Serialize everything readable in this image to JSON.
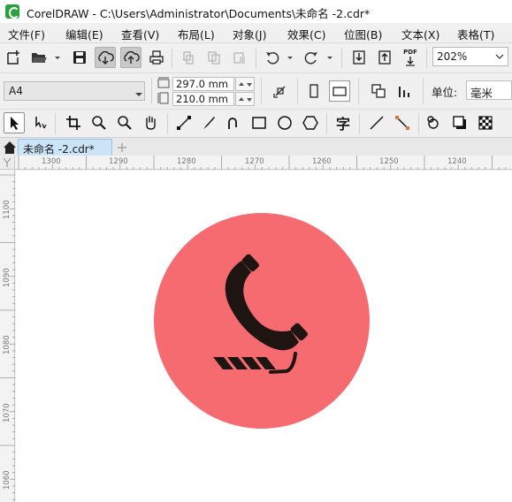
{
  "window": {
    "title": "CorelDRAW - C:\\Users\\Administrator\\Documents\\未命名 -2.cdr*"
  },
  "menu": [
    {
      "label": "文件(F)"
    },
    {
      "label": "编辑(E)"
    },
    {
      "label": "查看(V)"
    },
    {
      "label": "布局(L)"
    },
    {
      "label": "对象(J)"
    },
    {
      "label": "效果(C)"
    },
    {
      "label": "位图(B)"
    },
    {
      "label": "文本(X)"
    },
    {
      "label": "表格(T)"
    }
  ],
  "standard_toolbar": {
    "icons": [
      "new-document-icon",
      "open-folder-icon",
      "save-icon",
      "cloud-download-icon",
      "cloud-upload-icon",
      "print-icon",
      "cut-icon",
      "copy-icon",
      "paste-icon",
      "undo-icon",
      "redo-icon",
      "import-icon",
      "export-icon",
      "pdf-icon"
    ],
    "pdf_label": "PDF",
    "zoom_value": "202%"
  },
  "property_bar": {
    "page_size": "A4",
    "width": "297.0 mm",
    "height": "210.0 mm",
    "units_label": "单位:",
    "units_value": "毫米"
  },
  "toolbox": {
    "icons": [
      "pick-tool-icon",
      "shape-tool-icon",
      "crop-tool-icon",
      "zoom-tool-icon",
      "zoom-out-icon",
      "pan-tool-icon",
      "line-tool-icon",
      "pen-tool-icon",
      "bezier-tool-icon",
      "rectangle-tool-icon",
      "ellipse-tool-icon",
      "polygon-tool-icon",
      "text-tool-icon",
      "connector-tool-icon",
      "dimension-tool-icon",
      "fill-tool-icon",
      "shadow-tool-icon",
      "transparency-tool-icon"
    ],
    "text_tool_glyph": "字"
  },
  "document_tab": {
    "label": "未命名 -2.cdr*"
  },
  "ruler": {
    "horizontal": [
      "1300",
      "1290",
      "1280",
      "1270",
      "1260",
      "1250",
      "1240"
    ],
    "vertical": [
      "1100",
      "1090",
      "1080",
      "1070",
      "1060"
    ]
  },
  "artwork": {
    "circle_color": "#f66b70",
    "icon_color": "#1e1412"
  }
}
